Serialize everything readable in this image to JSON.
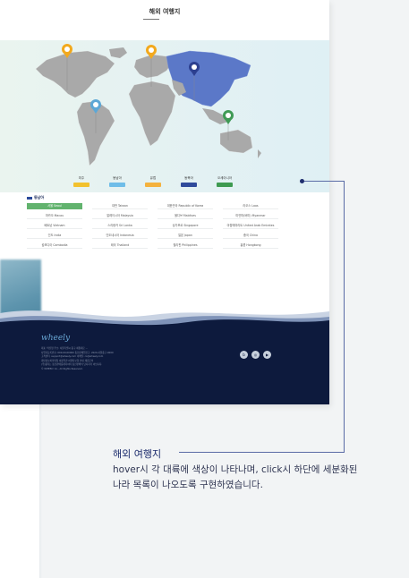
{
  "page": {
    "title": "해외 여행지"
  },
  "map": {
    "continent_colors": {
      "highlighted_asia": "#5b78c8",
      "default_land": "#a8a8a8",
      "pin_orange": "#f2a91d",
      "pin_blue": "#5ca7d6",
      "pin_green": "#3f9a55",
      "pin_navy": "#2c3f8f"
    },
    "legend": [
      {
        "label": "미주",
        "color": "#f2c12e"
      },
      {
        "label": "동남아",
        "color": "#6fbde8"
      },
      {
        "label": "유럽",
        "color": "#f4b23e"
      },
      {
        "label": "동북아",
        "color": "#2f4a9b"
      },
      {
        "label": "오세아니아",
        "color": "#3e9a51"
      }
    ]
  },
  "countries": {
    "region_label": "동남아",
    "items": [
      "대만 Taiwan",
      "대한민국 Republic of Korea",
      "라오스 Laos",
      "마카오 Macau",
      "말레이시아 Malaysia",
      "몰디브 Maldives",
      "미얀마(버마) Myanmar",
      "베트남 Vietnam",
      "스리랑카 Sri Lanka",
      "싱가포르 Singapore",
      "아랍에미리트 United Arab Emirates",
      "인도 India",
      "인도네시아 Indonesia",
      "일본 Japan",
      "중국 China",
      "캄보디아 Cambodia",
      "태국 Thailand",
      "필리핀 Philippines",
      "홍콩 Hongkong"
    ],
    "active_item": "서울 Seoul"
  },
  "footer": {
    "logo": "wheely",
    "info_lines": [
      "대표: 박진영     주소: 서울특별시 중구 세종대로 ...",
      "사업자등록번호: 000-00-00000   통신판매업신고: 2020-서울중구-0000",
      "고객센터: support@wheely.com   이메일: cs@wheely.com",
      "개인정보처리방침   이용약관   여행자보험 안내   제휴문의",
      "(주)휠리는 통신판매중개자이며 통신판매의 당사자가 아닙니다.",
      "© WHEELY Co., All Rights Reserved."
    ],
    "social_icons": [
      "blog-icon",
      "instagram-icon",
      "youtube-icon"
    ]
  },
  "annotation": {
    "title": "해외 여행지",
    "description": "hover시 각 대륙에 색상이 나타나며, click시 하단에 세분화된 나라 목록이 나오도록 구현하였습니다."
  }
}
